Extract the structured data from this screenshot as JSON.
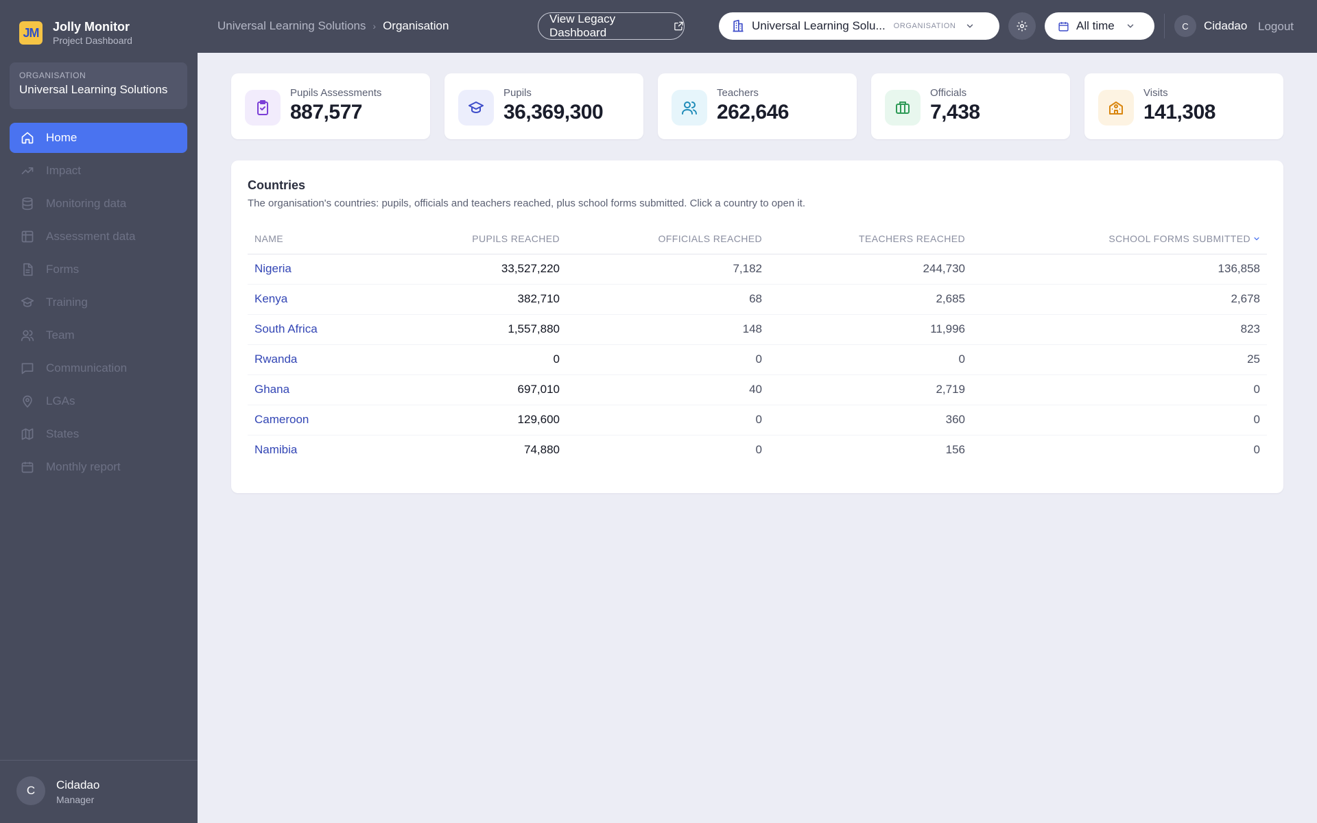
{
  "brand": {
    "logo_text": "JM",
    "title": "Jolly Monitor",
    "subtitle": "Project Dashboard"
  },
  "organisation": {
    "label": "ORGANISATION",
    "name": "Universal Learning Solutions"
  },
  "nav": [
    {
      "label": "Home",
      "icon": "home-icon"
    },
    {
      "label": "Impact",
      "icon": "trend-icon"
    },
    {
      "label": "Monitoring data",
      "icon": "database-icon"
    },
    {
      "label": "Assessment data",
      "icon": "table-icon"
    },
    {
      "label": "Forms",
      "icon": "document-icon"
    },
    {
      "label": "Training",
      "icon": "graduation-cap-icon"
    },
    {
      "label": "Team",
      "icon": "users-icon"
    },
    {
      "label": "Communication",
      "icon": "chat-icon"
    },
    {
      "label": "LGAs",
      "icon": "map-pin-icon"
    },
    {
      "label": "States",
      "icon": "map-icon"
    },
    {
      "label": "Monthly report",
      "icon": "calendar-icon"
    }
  ],
  "user": {
    "initial": "C",
    "name": "Cidadao",
    "role": "Manager"
  },
  "header": {
    "breadcrumb": [
      "Universal Learning Solutions",
      "Organisation"
    ],
    "legacy_label": "View Legacy Dashboard",
    "org_select": {
      "value": "Universal Learning Solu...",
      "tag": "ORGANISATION"
    },
    "time_select": "All time",
    "user_initial": "C",
    "user_name": "Cidadao",
    "logout": "Logout"
  },
  "stats": [
    {
      "label": "Pupils Assessments",
      "value": "887,577",
      "icon": "clipboard-check-icon",
      "color": "#7b3fd6",
      "bg": "#f2ecfc"
    },
    {
      "label": "Pupils",
      "value": "36,369,300",
      "icon": "graduation-cap-icon",
      "color": "#3d4cc9",
      "bg": "#eceefc"
    },
    {
      "label": "Teachers",
      "value": "262,646",
      "icon": "users-icon",
      "color": "#1e8bb8",
      "bg": "#e6f5fb"
    },
    {
      "label": "Officials",
      "value": "7,438",
      "icon": "briefcase-icon",
      "color": "#2e9a56",
      "bg": "#e8f7ee"
    },
    {
      "label": "Visits",
      "value": "141,308",
      "icon": "school-icon",
      "color": "#d9860f",
      "bg": "#fdf3e2"
    }
  ],
  "countries": {
    "title": "Countries",
    "description": "The organisation's countries: pupils, officials and teachers reached, plus school forms submitted. Click a country to open it.",
    "columns": [
      "NAME",
      "PUPILS REACHED",
      "OFFICIALS REACHED",
      "TEACHERS REACHED",
      "SCHOOL FORMS SUBMITTED"
    ],
    "rows": [
      {
        "name": "Nigeria",
        "pupils": "33,527,220",
        "officials": "7,182",
        "teachers": "244,730",
        "forms": "136,858"
      },
      {
        "name": "Kenya",
        "pupils": "382,710",
        "officials": "68",
        "teachers": "2,685",
        "forms": "2,678"
      },
      {
        "name": "South Africa",
        "pupils": "1,557,880",
        "officials": "148",
        "teachers": "11,996",
        "forms": "823"
      },
      {
        "name": "Rwanda",
        "pupils": "0",
        "officials": "0",
        "teachers": "0",
        "forms": "25"
      },
      {
        "name": "Ghana",
        "pupils": "697,010",
        "officials": "40",
        "teachers": "2,719",
        "forms": "0"
      },
      {
        "name": "Cameroon",
        "pupils": "129,600",
        "officials": "0",
        "teachers": "360",
        "forms": "0"
      },
      {
        "name": "Namibia",
        "pupils": "74,880",
        "officials": "0",
        "teachers": "156",
        "forms": "0"
      }
    ]
  },
  "colors": {
    "accent": "#4a73f0",
    "sidebar": "#474b5c",
    "link": "#3346b5",
    "background": "#ecedf5"
  }
}
